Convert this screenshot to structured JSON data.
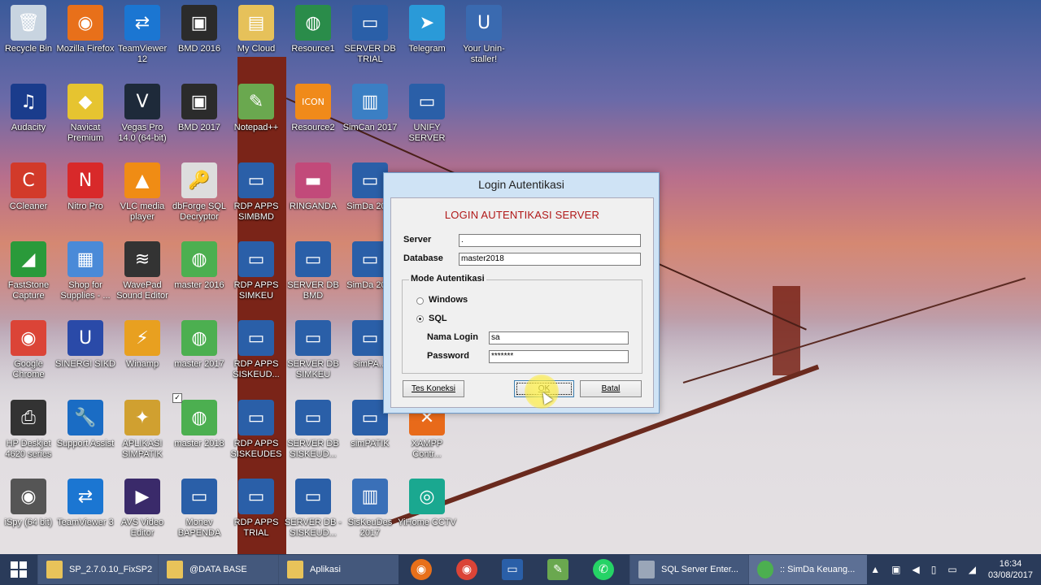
{
  "desktop": {
    "icons": [
      {
        "label": "Recycle Bin",
        "icon": "recycle-bin-icon",
        "color": "#c8d4e0",
        "glyph": "🗑"
      },
      {
        "label": "Mozilla Firefox",
        "icon": "firefox-icon",
        "color": "#e8701a",
        "glyph": "◉"
      },
      {
        "label": "TeamViewer 12",
        "icon": "teamviewer-icon",
        "color": "#1b76d2",
        "glyph": "⇄"
      },
      {
        "label": "BMD 2016",
        "icon": "bmd-icon",
        "color": "#2b2b2b",
        "glyph": "▣"
      },
      {
        "label": "My Cloud",
        "icon": "folder-icon",
        "color": "#e6c15a",
        "glyph": "▤"
      },
      {
        "label": "Resource1",
        "icon": "globe-icon",
        "color": "#2a8c4a",
        "glyph": "◍"
      },
      {
        "label": "SERVER DB TRIAL",
        "icon": "remote-desktop-icon",
        "color": "#2a5fa8",
        "glyph": "▭"
      },
      {
        "label": "Telegram",
        "icon": "telegram-icon",
        "color": "#2a9ad8",
        "glyph": "➤"
      },
      {
        "label": "Your Unin-staller!",
        "icon": "uninstaller-icon",
        "color": "#3a6ab0",
        "glyph": "U"
      },
      {
        "label": "Audacity",
        "icon": "audacity-icon",
        "color": "#1a3c8c",
        "glyph": "♫"
      },
      {
        "label": "Navicat Premium",
        "icon": "navicat-icon",
        "color": "#e6c430",
        "glyph": "◆"
      },
      {
        "label": "Vegas Pro 14.0 (64-bit)",
        "icon": "vegas-icon",
        "color": "#1e2a3a",
        "glyph": "V"
      },
      {
        "label": "BMD 2017",
        "icon": "bmd-icon",
        "color": "#2b2b2b",
        "glyph": "▣"
      },
      {
        "label": "Notepad++",
        "icon": "notepad-icon",
        "color": "#6aa84f",
        "glyph": "✎"
      },
      {
        "label": "Resource2",
        "icon": "resource-icon",
        "color": "#f08a1a",
        "glyph": "ICON"
      },
      {
        "label": "SimCan 2017",
        "icon": "simcan-icon",
        "color": "#3b7fc4",
        "glyph": "▥"
      },
      {
        "label": "UNIFY SERVER",
        "icon": "remote-desktop-icon",
        "color": "#2a5fa8",
        "glyph": "▭"
      },
      {
        "label": "CCleaner",
        "icon": "ccleaner-icon",
        "color": "#d23a2a",
        "glyph": "C"
      },
      {
        "label": "Nitro Pro",
        "icon": "nitro-icon",
        "color": "#d8292a",
        "glyph": "N"
      },
      {
        "label": "VLC media player",
        "icon": "vlc-icon",
        "color": "#f08c14",
        "glyph": "▲"
      },
      {
        "label": "dbForge SQL Decryptor",
        "icon": "dbforge-icon",
        "color": "#ddd",
        "glyph": "🔑"
      },
      {
        "label": "RDP APPS SIMBMD",
        "icon": "remote-desktop-icon",
        "color": "#2a5fa8",
        "glyph": "▭"
      },
      {
        "label": "RINGANDA",
        "icon": "ringanda-icon",
        "color": "#c24a7a",
        "glyph": "▬"
      },
      {
        "label": "SimDa 20...",
        "icon": "remote-desktop-icon",
        "color": "#2a5fa8",
        "glyph": "▭"
      },
      {
        "label": "FastStone Capture",
        "icon": "faststone-icon",
        "color": "#2a9a3a",
        "glyph": "◢"
      },
      {
        "label": "Shop for Supplies - ...",
        "icon": "shop-icon",
        "color": "#4a8ad8",
        "glyph": "▦"
      },
      {
        "label": "WavePad Sound Editor",
        "icon": "wavepad-icon",
        "color": "#333",
        "glyph": "≋"
      },
      {
        "label": "master 2016",
        "icon": "globe-icon",
        "color": "#4caf50",
        "glyph": "◍"
      },
      {
        "label": "RDP APPS SIMKEU",
        "icon": "remote-desktop-icon",
        "color": "#2a5fa8",
        "glyph": "▭"
      },
      {
        "label": "SERVER DB BMD",
        "icon": "remote-desktop-icon",
        "color": "#2a5fa8",
        "glyph": "▭"
      },
      {
        "label": "SimDa 20...",
        "icon": "remote-desktop-icon",
        "color": "#2a5fa8",
        "glyph": "▭"
      },
      {
        "label": "Google Chrome",
        "icon": "chrome-icon",
        "color": "#db4437",
        "glyph": "◉"
      },
      {
        "label": "SINERGI SIKD",
        "icon": "sinergi-icon",
        "color": "#2a4aa8",
        "glyph": "U"
      },
      {
        "label": "Winamp",
        "icon": "winamp-icon",
        "color": "#e8a020",
        "glyph": "⚡"
      },
      {
        "label": "master 2017",
        "icon": "globe-icon",
        "color": "#4caf50",
        "glyph": "◍"
      },
      {
        "label": "RDP APPS SISKEUD...",
        "icon": "remote-desktop-icon",
        "color": "#2a5fa8",
        "glyph": "▭"
      },
      {
        "label": "SERVER DB SIMKEU",
        "icon": "remote-desktop-icon",
        "color": "#2a5fa8",
        "glyph": "▭"
      },
      {
        "label": "simPA...",
        "icon": "remote-desktop-icon",
        "color": "#2a5fa8",
        "glyph": "▭"
      },
      {
        "label": "HP Deskjet 4620 series",
        "icon": "printer-icon",
        "color": "#333",
        "glyph": "⎙"
      },
      {
        "label": "Support Assist",
        "icon": "support-icon",
        "color": "#1a6cc4",
        "glyph": "🔧"
      },
      {
        "label": "APLIKASI SIMPATIK",
        "icon": "aplikasi-icon",
        "color": "#d0a030",
        "glyph": "✦"
      },
      {
        "label": "master 2018",
        "icon": "globe-icon",
        "color": "#4caf50",
        "glyph": "◍",
        "checked": true
      },
      {
        "label": "RDP APPS SISKEUDES",
        "icon": "remote-desktop-icon",
        "color": "#2a5fa8",
        "glyph": "▭"
      },
      {
        "label": "SERVER DB SISKEUD...",
        "icon": "remote-desktop-icon",
        "color": "#2a5fa8",
        "glyph": "▭"
      },
      {
        "label": "simPATIK",
        "icon": "remote-desktop-icon",
        "color": "#2a5fa8",
        "glyph": "▭"
      },
      {
        "label": "XAMPP Contr...",
        "icon": "xampp-icon",
        "color": "#e86a1a",
        "glyph": "✕"
      },
      {
        "label": "iSpy (64 bit)",
        "icon": "ispy-icon",
        "color": "#555",
        "glyph": "◉"
      },
      {
        "label": "TeamViewer 3",
        "icon": "teamviewer-icon",
        "color": "#1b76d2",
        "glyph": "⇄"
      },
      {
        "label": "AVS Video Editor",
        "icon": "avs-icon",
        "color": "#3a2a6a",
        "glyph": "▶"
      },
      {
        "label": "Monev BAPENDA",
        "icon": "remote-desktop-icon",
        "color": "#2a5fa8",
        "glyph": "▭"
      },
      {
        "label": "RDP APPS TRIAL",
        "icon": "remote-desktop-icon",
        "color": "#2a5fa8",
        "glyph": "▭"
      },
      {
        "label": "SERVER DB - SISKEUD...",
        "icon": "remote-desktop-icon",
        "color": "#2a5fa8",
        "glyph": "▭"
      },
      {
        "label": "SisKeuDes 2017",
        "icon": "siskeudes-icon",
        "color": "#3a70b8",
        "glyph": "▥"
      },
      {
        "label": "YiHome CCTV",
        "icon": "yihome-icon",
        "color": "#1aa890",
        "glyph": "◎"
      }
    ]
  },
  "dialog": {
    "title": "Login Autentikasi",
    "heading": "LOGIN AUTENTIKASI SERVER",
    "server_label": "Server",
    "server_value": ".",
    "database_label": "Database",
    "database_value": "master2018",
    "mode_title": "Mode Autentikasi",
    "radio_windows": "Windows",
    "radio_sql": "SQL",
    "login_label": "Nama Login",
    "login_value": "sa",
    "password_label": "Password",
    "password_value": "*******",
    "btn_test": "Tes Koneksi",
    "btn_ok": "OK",
    "btn_cancel": "Batal"
  },
  "taskbar": {
    "tasks": [
      {
        "label": "SP_2.7.0.10_FixSP2",
        "icon": "folder-icon"
      },
      {
        "label": "@DATA BASE",
        "icon": "folder-icon"
      },
      {
        "label": "Aplikasi",
        "icon": "folder-icon"
      }
    ],
    "pinned": [
      "firefox-icon",
      "chrome-icon",
      "remote-desktop-icon",
      "notepad-icon",
      "whatsapp-icon"
    ],
    "windows": [
      {
        "label": "SQL Server Enter...",
        "icon": "sql-server-icon"
      },
      {
        "label": ":: SimDa Keuang...",
        "icon": "globe-icon"
      }
    ],
    "time": "16:34",
    "date": "03/08/2017"
  }
}
